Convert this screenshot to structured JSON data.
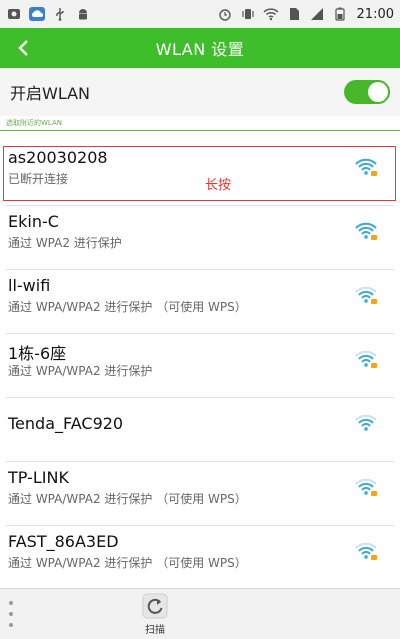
{
  "status_bar": {
    "time": "21:00",
    "left_icons": [
      "notification-icon",
      "cloud-icon",
      "usb-icon",
      "android-icon"
    ],
    "right_icons": [
      "alarm-icon",
      "vibrate-icon",
      "wifi-icon",
      "sim-icon",
      "signal-icon",
      "battery-icon"
    ]
  },
  "header": {
    "title": "WLAN 设置",
    "back_icon": "chevron-left-icon"
  },
  "wlan_toggle": {
    "label": "开启WLAN",
    "on": true
  },
  "section": {
    "label": "选取附近的WLAN"
  },
  "annotation": {
    "label": "长按"
  },
  "networks": [
    {
      "ssid": "as20030208",
      "status": "已断开连接",
      "secured": true
    },
    {
      "ssid": "Ekin-C",
      "status": "通过 WPA2 进行保护",
      "secured": true
    },
    {
      "ssid": "ll-wifi",
      "status": "通过 WPA/WPA2 进行保护 （可使用 WPS）",
      "secured": true
    },
    {
      "ssid": "1栋-6座",
      "status": "通过 WPA/WPA2 进行保护",
      "secured": true
    },
    {
      "ssid": "Tenda_FAC920",
      "status": "",
      "secured": false
    },
    {
      "ssid": "TP-LINK",
      "status": "通过 WPA/WPA2 进行保护 （可使用 WPS）",
      "secured": true
    },
    {
      "ssid": "FAST_86A3ED",
      "status": "通过 WPA/WPA2 进行保护 （可使用 WPS）",
      "secured": true
    }
  ],
  "bottom_bar": {
    "scan_label": "扫描",
    "menu_icon": "more-vert-icon",
    "scan_icon": "refresh-icon"
  },
  "colors": {
    "accent": "#3fbe2b",
    "wifi_icon": "#39a9d6",
    "lock": "#f2a516",
    "highlight": "#e53935"
  }
}
